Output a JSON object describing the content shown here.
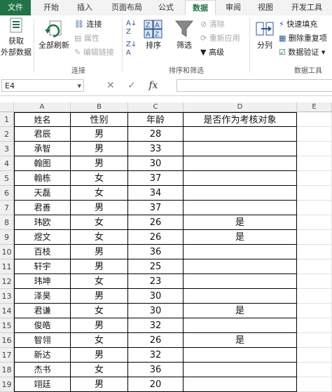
{
  "tabs": [
    {
      "label": "文件",
      "state": "file"
    },
    {
      "label": "开始",
      "state": "normal"
    },
    {
      "label": "插入",
      "state": "normal"
    },
    {
      "label": "页面布局",
      "state": "normal"
    },
    {
      "label": "公式",
      "state": "normal"
    },
    {
      "label": "数据",
      "state": "active"
    },
    {
      "label": "审阅",
      "state": "normal"
    },
    {
      "label": "视图",
      "state": "normal"
    },
    {
      "label": "开发工具",
      "state": "normal"
    }
  ],
  "ribbon": {
    "get_data_line1": "获取",
    "get_data_line2": "外部数据",
    "refresh_all": "全部刷新",
    "connections": "连接",
    "properties": "属性",
    "edit_links": "编辑链接",
    "group_connections": "连接",
    "sort": "排序",
    "filter": "筛选",
    "clear": "清除",
    "reapply": "重新应用",
    "advanced": "高级",
    "group_sort_filter": "排序和筛选",
    "text_to_columns": "分列",
    "flash_fill": "快速填充",
    "remove_duplicates": "删除重复项",
    "data_validation": "数据验证",
    "group_data_tools": "数据工具"
  },
  "formula_bar": {
    "name_box": "E4",
    "fx": "fx",
    "formula": ""
  },
  "sheet": {
    "columns": [
      "A",
      "B",
      "C",
      "D",
      "E"
    ],
    "header_row": [
      "姓名",
      "性别",
      "年龄",
      "是否作为考核对象"
    ],
    "rows": [
      [
        "君辰",
        "男",
        "28",
        ""
      ],
      [
        "承智",
        "男",
        "33",
        ""
      ],
      [
        "翰图",
        "男",
        "30",
        ""
      ],
      [
        "翰栋",
        "女",
        "37",
        ""
      ],
      [
        "天磊",
        "女",
        "34",
        ""
      ],
      [
        "君善",
        "男",
        "37",
        ""
      ],
      [
        "玮欧",
        "女",
        "26",
        "是"
      ],
      [
        "煜文",
        "女",
        "26",
        "是"
      ],
      [
        "百枝",
        "男",
        "36",
        ""
      ],
      [
        "轩宇",
        "男",
        "25",
        ""
      ],
      [
        "玮坤",
        "女",
        "23",
        ""
      ],
      [
        "泽昊",
        "男",
        "30",
        ""
      ],
      [
        "君谦",
        "女",
        "30",
        "是"
      ],
      [
        "俊皓",
        "男",
        "32",
        ""
      ],
      [
        "智翎",
        "女",
        "26",
        "是"
      ],
      [
        "新达",
        "男",
        "32",
        ""
      ],
      [
        "杰书",
        "女",
        "36",
        ""
      ],
      [
        "翊廷",
        "男",
        "20",
        ""
      ]
    ],
    "row_numbers": [
      "1",
      "2",
      "3",
      "4",
      "5",
      "6",
      "7",
      "8",
      "9",
      "10",
      "11",
      "12",
      "13",
      "14",
      "15",
      "16",
      "17",
      "18",
      "19"
    ]
  }
}
